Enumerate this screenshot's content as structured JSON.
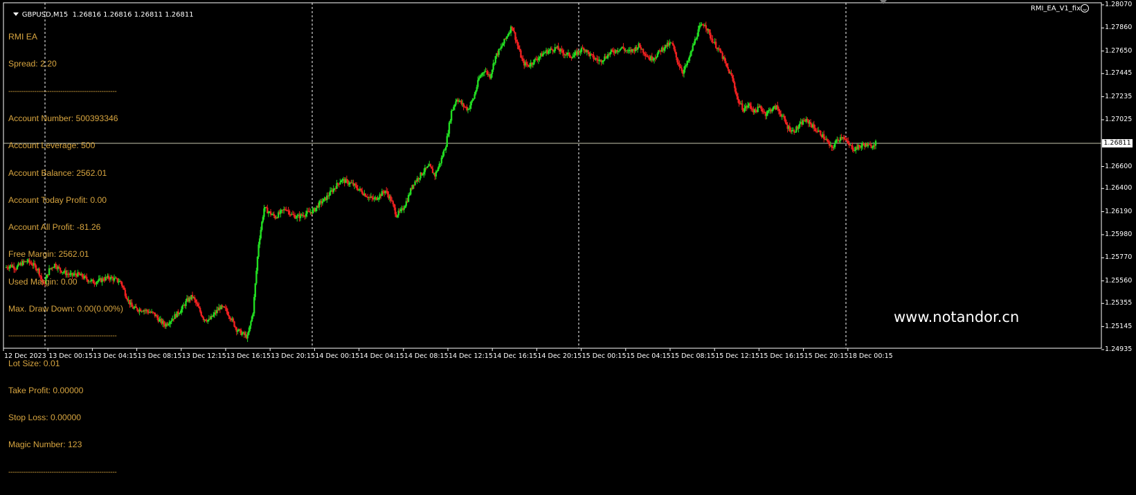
{
  "window": {
    "symbol": "GBPUSD,M15",
    "ohlc": "1.26816 1.26816 1.26811 1.26811",
    "ea_name": "RMI_EA_V1_fix",
    "watermark": "www.notandor.cn"
  },
  "info_panel": {
    "separator": "--------------------------------------------------",
    "lines": {
      "ea_title": "RMI EA",
      "spread": "Spread: 2.20",
      "account_number": "Account Number: 500393346",
      "account_leverage": "Account Leverage: 500",
      "account_balance": "Account Balance: 2562.01",
      "today_profit": "Account Today Profit: 0.00",
      "all_profit": "Account All Profit: -81.26",
      "free_margin": "Free Margin: 2562.01",
      "used_margin": "Used Margin: 0.00",
      "max_drawdown": "Max. Draw Down: 0.00(0.00%)",
      "lot_size": "Lot Size: 0.01",
      "take_profit": "Take Profit: 0.00000",
      "stop_loss": "Stop Loss: 0.00000",
      "magic_number": "Magic Number: 123"
    }
  },
  "colors": {
    "background": "#000000",
    "bull": "#22dd22",
    "bear": "#ee2020",
    "wick_bull": "#22dd22",
    "wick_bear": "#ee2020",
    "axis_text": "#ffffff",
    "info_text": "#d9a640",
    "grid": "#ffffff",
    "bid_line": "#c8c8b0"
  },
  "chart_data": {
    "type": "candlestick",
    "symbol": "GBPUSD",
    "timeframe": "M15",
    "y_ticks": [
      "1.28070",
      "1.27860",
      "1.27650",
      "1.27445",
      "1.27235",
      "1.27025",
      "1.26811",
      "1.26600",
      "1.26400",
      "1.26190",
      "1.25980",
      "1.25770",
      "1.25560",
      "1.25355",
      "1.25145",
      "1.24935"
    ],
    "ylim": [
      1.24935,
      1.2807
    ],
    "bid": 1.26811,
    "bid_label": "1.26811",
    "x_ticks": [
      "12 Dec 2023",
      "13 Dec 00:15",
      "13 Dec 04:15",
      "13 Dec 08:15",
      "13 Dec 12:15",
      "13 Dec 16:15",
      "13 Dec 20:15",
      "14 Dec 00:15",
      "14 Dec 04:15",
      "14 Dec 08:15",
      "14 Dec 12:15",
      "14 Dec 16:15",
      "14 Dec 20:15",
      "15 Dec 00:15",
      "15 Dec 04:15",
      "15 Dec 08:15",
      "15 Dec 12:15",
      "15 Dec 16:15",
      "15 Dec 20:15",
      "18 Dec 00:15"
    ],
    "day_separators": [
      "13 Dec 00:15",
      "14 Dec 00:15",
      "15 Dec 00:15",
      "18 Dec 00:15"
    ],
    "close_path": [
      1.2568,
      1.257,
      1.2568,
      1.2572,
      1.2574,
      1.2571,
      1.2566,
      1.2552,
      1.2566,
      1.2571,
      1.2566,
      1.2563,
      1.2561,
      1.2562,
      1.256,
      1.2557,
      1.2555,
      1.2556,
      1.2558,
      1.2559,
      1.2557,
      1.2555,
      1.2542,
      1.2532,
      1.253,
      1.253,
      1.2528,
      1.2526,
      1.252,
      1.2516,
      1.252,
      1.2525,
      1.253,
      1.2538,
      1.2542,
      1.2532,
      1.2522,
      1.252,
      1.2526,
      1.2532,
      1.253,
      1.2522,
      1.2512,
      1.2508,
      1.2505,
      1.2528,
      1.259,
      1.2622,
      1.2618,
      1.2614,
      1.2618,
      1.2622,
      1.2616,
      1.2614,
      1.2616,
      1.2618,
      1.262,
      1.2626,
      1.263,
      1.2636,
      1.2642,
      1.2648,
      1.2646,
      1.2644,
      1.264,
      1.2636,
      1.2632,
      1.263,
      1.2634,
      1.2638,
      1.263,
      1.2616,
      1.262,
      1.263,
      1.2644,
      1.265,
      1.2656,
      1.266,
      1.2652,
      1.2664,
      1.268,
      1.271,
      1.2722,
      1.2716,
      1.2712,
      1.2722,
      1.274,
      1.2748,
      1.2742,
      1.276,
      1.2768,
      1.2778,
      1.2788,
      1.277,
      1.2754,
      1.2752,
      1.2756,
      1.276,
      1.2764,
      1.2766,
      1.2768,
      1.2764,
      1.2762,
      1.276,
      1.2764,
      1.2768,
      1.2762,
      1.2758,
      1.2756,
      1.276,
      1.2764,
      1.2766,
      1.2768,
      1.2764,
      1.2766,
      1.277,
      1.2764,
      1.2758,
      1.276,
      1.2766,
      1.277,
      1.2772,
      1.2756,
      1.2746,
      1.2756,
      1.2772,
      1.2786,
      1.279,
      1.2778,
      1.277,
      1.2762,
      1.275,
      1.274,
      1.272,
      1.2712,
      1.2716,
      1.271,
      1.2714,
      1.2708,
      1.2712,
      1.2714,
      1.2706,
      1.2696,
      1.2692,
      1.2696,
      1.2702,
      1.27,
      1.2694,
      1.269,
      1.2684,
      1.2676,
      1.2684,
      1.2688,
      1.268,
      1.2676,
      1.2678,
      1.268,
      1.2678,
      1.2682
    ]
  }
}
